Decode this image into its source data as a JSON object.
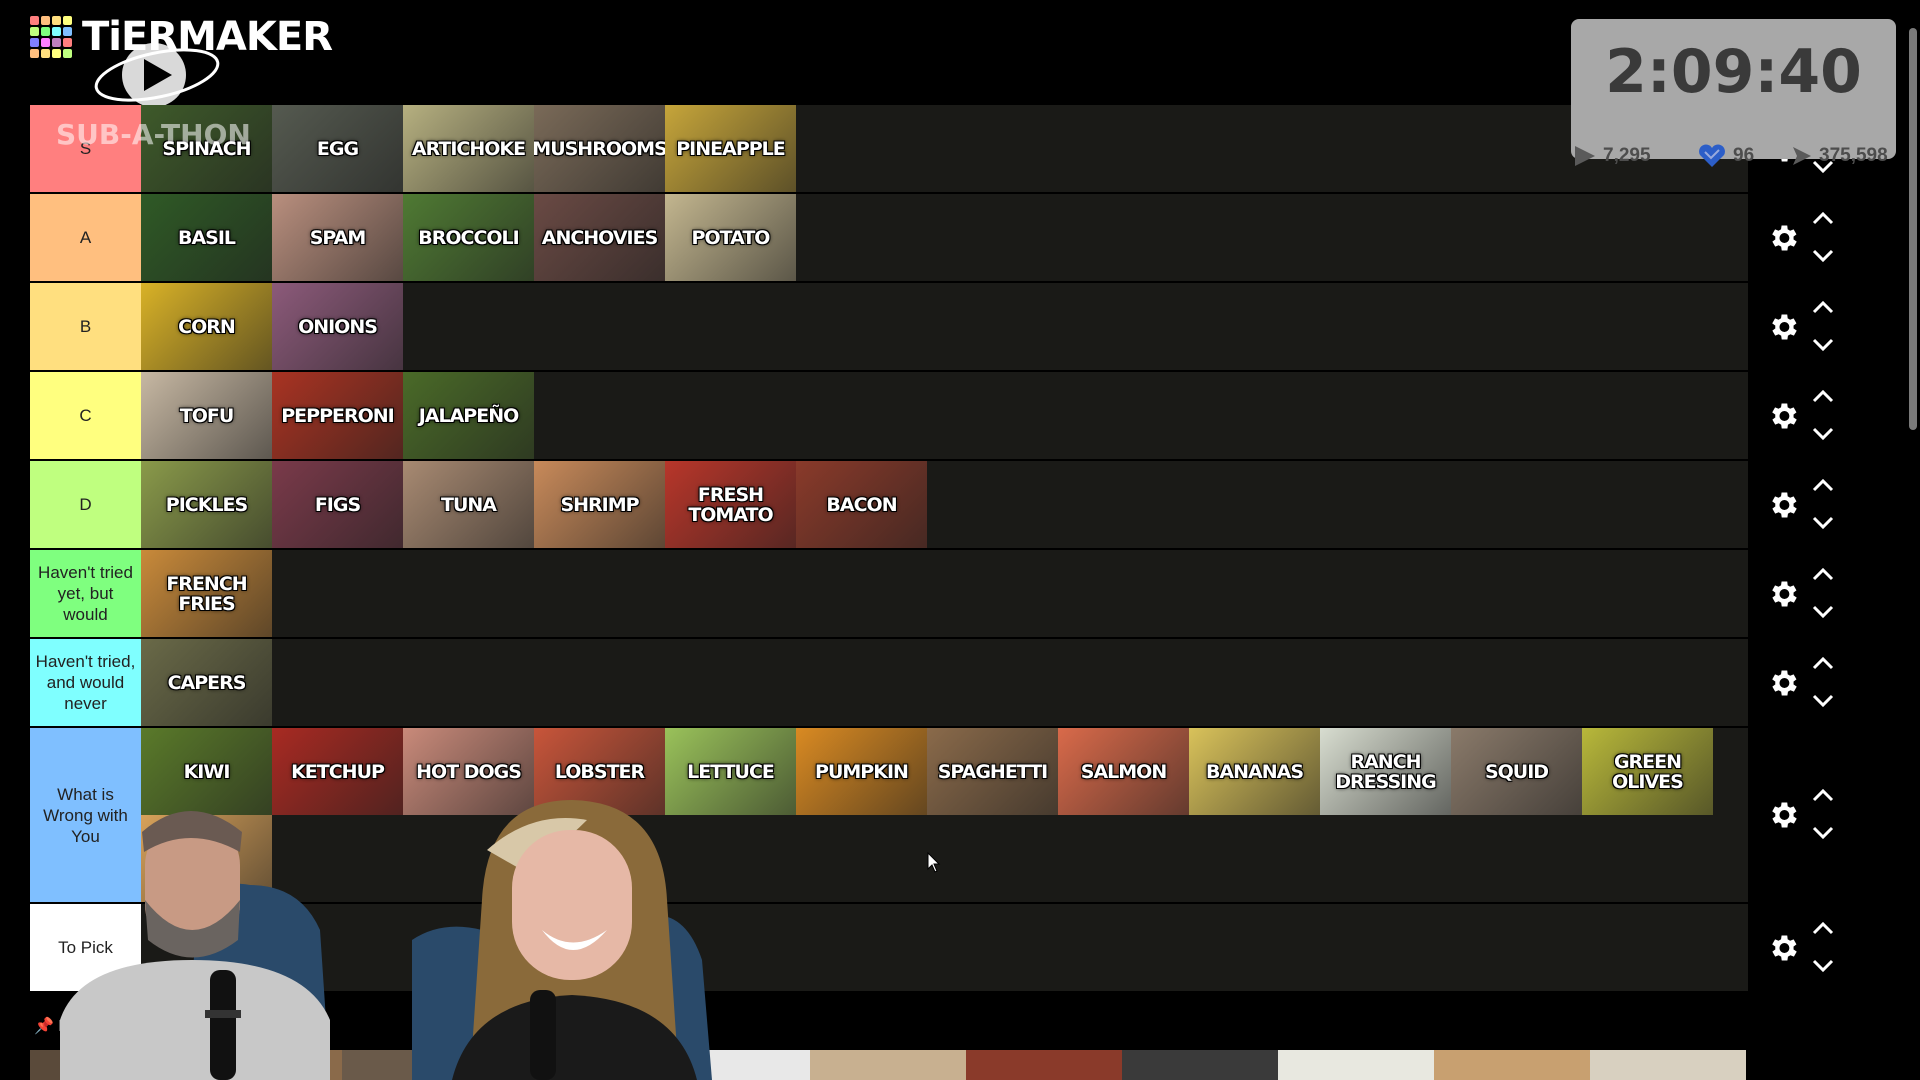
{
  "app": {
    "logo_text": "TiERMAKER",
    "overlay_text": "SUB-A-THON"
  },
  "timer": {
    "time": "2:09:40",
    "subs": "7,295",
    "gifts": "96",
    "bits": "375,598"
  },
  "colors": {
    "logo_grid": [
      "#ff7f7f",
      "#ffbf7f",
      "#ffdf7f",
      "#ffff7f",
      "#bfff7f",
      "#7fff7f",
      "#7fffff",
      "#7fbfff",
      "#7f7fff",
      "#ff7fff",
      "#bf7fbf",
      "#ff7f7f",
      "#ffbf7f",
      "#ffdf7f",
      "#ffff7f",
      "#bfff7f"
    ]
  },
  "tiers": [
    {
      "label": "S",
      "color": "#ff7f7f",
      "items": [
        {
          "label": "SPINACH",
          "bg": "#3e5a2a"
        },
        {
          "label": "EGG",
          "bg": "#555a50"
        },
        {
          "label": "ARTICHOKE",
          "bg": "#b6b080"
        },
        {
          "label": "MUSHROOMS",
          "bg": "#7a6a58"
        },
        {
          "label": "PINEAPPLE",
          "bg": "#c6a53a"
        }
      ]
    },
    {
      "label": "A",
      "color": "#ffbf7f",
      "items": [
        {
          "label": "BASIL",
          "bg": "#2f5a26"
        },
        {
          "label": "SPAM",
          "bg": "#b98f7e"
        },
        {
          "label": "BROCCOLI",
          "bg": "#4f7a33"
        },
        {
          "label": "ANCHOVIES",
          "bg": "#6a4a44"
        },
        {
          "label": "POTATO",
          "bg": "#c3b68f"
        }
      ]
    },
    {
      "label": "B",
      "color": "#ffdf7f",
      "items": [
        {
          "label": "CORN",
          "bg": "#d9b227"
        },
        {
          "label": "ONIONS",
          "bg": "#8c5a7a"
        }
      ]
    },
    {
      "label": "C",
      "color": "#ffff7f",
      "items": [
        {
          "label": "TOFU",
          "bg": "#c7b8a3"
        },
        {
          "label": "PEPPERONI",
          "bg": "#a93322"
        },
        {
          "label": "JALAPEÑO",
          "bg": "#4a6a28"
        }
      ]
    },
    {
      "label": "D",
      "color": "#bfff7f",
      "items": [
        {
          "label": "PICKLES",
          "bg": "#8a9a4a"
        },
        {
          "label": "FIGS",
          "bg": "#7a3a4a"
        },
        {
          "label": "TUNA",
          "bg": "#a88a72"
        },
        {
          "label": "SHRIMP",
          "bg": "#c88a5a"
        },
        {
          "label": "FRESH TOMATO",
          "bg": "#b8362a"
        },
        {
          "label": "BACON",
          "bg": "#8a3a2a"
        }
      ]
    },
    {
      "label": "Haven't tried yet, but would",
      "color": "#7fff7f",
      "items": [
        {
          "label": "FRENCH FRIES",
          "bg": "#c98a3a"
        }
      ]
    },
    {
      "label": "Haven't tried, and would never",
      "color": "#7fffff",
      "items": [
        {
          "label": "CAPERS",
          "bg": "#6a6a48"
        }
      ]
    },
    {
      "label": "What is Wrong with You",
      "color": "#7fbfff",
      "items": [
        {
          "label": "KIWI",
          "bg": "#5a7a2a"
        },
        {
          "label": "KETCHUP",
          "bg": "#a82a22"
        },
        {
          "label": "HOT DOGS",
          "bg": "#c98a7a"
        },
        {
          "label": "LOBSTER",
          "bg": "#c8553a"
        },
        {
          "label": "LETTUCE",
          "bg": "#9ac25a"
        },
        {
          "label": "PUMPKIN",
          "bg": "#d98a22"
        },
        {
          "label": "SPAGHETTI",
          "bg": "#8a6a4a"
        },
        {
          "label": "SALMON",
          "bg": "#d96a4a"
        },
        {
          "label": "BANANAS",
          "bg": "#d9c25a"
        },
        {
          "label": "RANCH DRESSING",
          "bg": "#d8ddd0"
        },
        {
          "label": "SQUID",
          "bg": "#8a7a6a"
        },
        {
          "label": "GREEN OLIVES",
          "bg": "#b8b83a"
        },
        {
          "label": "",
          "bg": "#d8a25a"
        }
      ]
    },
    {
      "label": "To Pick",
      "color": "#ffffff",
      "items": []
    }
  ],
  "pinned_label": "P",
  "bottom_strip": [
    "#5a4a3a",
    "#8a6a4a",
    "#6a5a4a",
    "#d98a22",
    "#e8e8e8",
    "#c8b090",
    "#8a3a2a",
    "#3a3a3a",
    "#e8e8e0",
    "#c8a070",
    "#d8d0c0"
  ]
}
